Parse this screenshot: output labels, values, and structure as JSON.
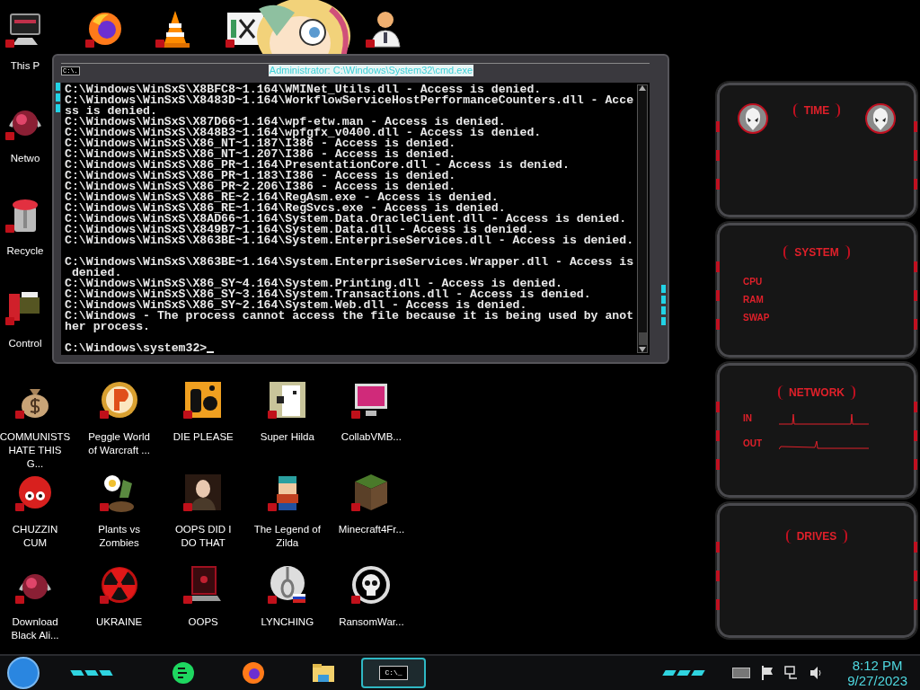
{
  "top_icons": [
    {
      "kind": "pc",
      "label": "This P"
    },
    {
      "kind": "firefox"
    },
    {
      "kind": "vlc"
    },
    {
      "kind": "hex"
    },
    {
      "kind": "user"
    }
  ],
  "left_icons": [
    {
      "kind": "orb",
      "label": "Netwo"
    },
    {
      "kind": "bin",
      "label": "Recycle"
    },
    {
      "kind": "control",
      "label": "Control"
    }
  ],
  "desktop_icons": [
    {
      "kind": "money",
      "label": "COMMUNISTS HATE THIS G..."
    },
    {
      "kind": "peggle",
      "label": "Peggle World of Warcraft ..."
    },
    {
      "kind": "die",
      "label": "DIE PLEASE"
    },
    {
      "kind": "pixelcat",
      "label": "Super Hilda"
    },
    {
      "kind": "collab",
      "label": "CollabVMB..."
    },
    {
      "kind": "fuzz",
      "label": "CHUZZIN CUM"
    },
    {
      "kind": "plant",
      "label": "Plants vs Zombies"
    },
    {
      "kind": "portrait",
      "label": "OOPS DID I DO THAT"
    },
    {
      "kind": "pixelhero",
      "label": "The Legend of Zilda"
    },
    {
      "kind": "block",
      "label": "Minecraft4Fr..."
    },
    {
      "kind": "orb",
      "label": "Download Black Ali..."
    },
    {
      "kind": "radiation",
      "label": "UKRAINE"
    },
    {
      "kind": "laptop",
      "label": "OOPS"
    },
    {
      "kind": "rope",
      "label": "LYNCHING"
    },
    {
      "kind": "skull",
      "label": "RansomWar..."
    }
  ],
  "cmd_window": {
    "title": "Administrator: C:\\Windows\\System32\\cmd.exe",
    "icon_text": "C:\\.",
    "output_blocks": [
      [
        "C:\\Windows\\WinSxS\\X8BFC8~1.164\\WMINet_Utils.dll - Access is denied.",
        "C:\\Windows\\WinSxS\\X8483D~1.164\\WorkflowServiceHostPerformanceCounters.dll - Acce",
        "ss is denied.",
        "C:\\Windows\\WinSxS\\X87D66~1.164\\wpf-etw.man - Access is denied.",
        "C:\\Windows\\WinSxS\\X848B3~1.164\\wpfgfx_v0400.dll - Access is denied.",
        "C:\\Windows\\WinSxS\\X86_NT~1.187\\I386 - Access is denied.",
        "C:\\Windows\\WinSxS\\X86_NT~1.207\\I386 - Access is denied.",
        "C:\\Windows\\WinSxS\\X86_PR~1.164\\PresentationCore.dll - Access is denied.",
        "C:\\Windows\\WinSxS\\X86_PR~1.183\\I386 - Access is denied.",
        "C:\\Windows\\WinSxS\\X86_PR~2.206\\I386 - Access is denied.",
        "C:\\Windows\\WinSxS\\X86_RE~2.164\\RegAsm.exe - Access is denied.",
        "C:\\Windows\\WinSxS\\X86_RE~1.164\\RegSvcs.exe - Access is denied.",
        "C:\\Windows\\WinSxS\\X8AD66~1.164\\System.Data.OracleClient.dll - Access is denied.",
        "C:\\Windows\\WinSxS\\X849B7~1.164\\System.Data.dll - Access is denied.",
        "C:\\Windows\\WinSxS\\X863BE~1.164\\System.EnterpriseServices.dll - Access is denied."
      ],
      [
        "C:\\Windows\\WinSxS\\X863BE~1.164\\System.EnterpriseServices.Wrapper.dll - Access is",
        " denied.",
        "C:\\Windows\\WinSxS\\X86_SY~4.164\\System.Printing.dll - Access is denied.",
        "C:\\Windows\\WinSxS\\X86_SY~3.164\\System.Transactions.dll - Access is denied.",
        "C:\\Windows\\WinSxS\\X86_SY~2.164\\System.Web.dll - Access is denied.",
        "C:\\Windows - The process cannot access the file because it is being used by anot",
        "her process."
      ]
    ],
    "prompt": "C:\\Windows\\system32>"
  },
  "gadgets": [
    {
      "kind": "time",
      "title": "TIME"
    },
    {
      "kind": "system",
      "title": "SYSTEM",
      "rows": [
        "CPU",
        "RAM",
        "SWAP"
      ]
    },
    {
      "kind": "network",
      "title": "NETWORK",
      "rows": [
        "IN",
        "OUT"
      ]
    },
    {
      "kind": "drives",
      "title": "DRIVES"
    }
  ],
  "taskbar": {
    "apps": [
      {
        "kind": "chat",
        "selected": false
      },
      {
        "kind": "firefox",
        "selected": false
      },
      {
        "kind": "explorer",
        "selected": false
      },
      {
        "kind": "cmd",
        "selected": true,
        "text": "C:\\_"
      }
    ],
    "clock": {
      "time": "8:12 PM",
      "date": "9/27/2023"
    }
  }
}
